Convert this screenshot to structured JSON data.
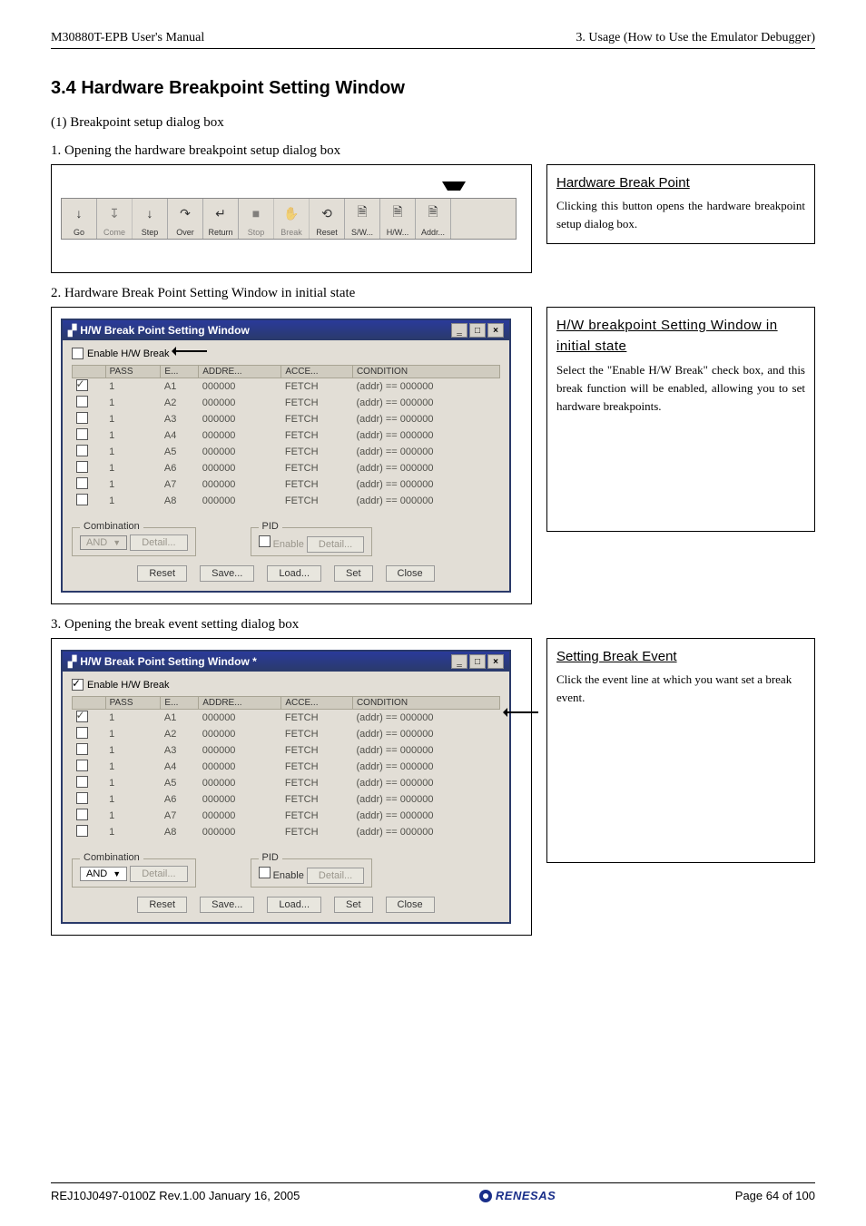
{
  "header": {
    "left": "M30880T-EPB User's Manual",
    "right": "3. Usage (How to Use the Emulator Debugger)"
  },
  "section_title": "3.4 Hardware Breakpoint Setting Window",
  "sub1": "(1) Breakpoint setup dialog box",
  "step1": "1. Opening the hardware breakpoint setup dialog box",
  "step2": "2. Hardware Break Point Setting Window in initial state",
  "step3": "3. Opening the break event setting dialog box",
  "toolbar": [
    {
      "label": "Go",
      "enabled": true,
      "icon": "↓"
    },
    {
      "label": "Come",
      "enabled": false,
      "icon": "↧"
    },
    {
      "label": "Step",
      "enabled": true,
      "icon": "↓"
    },
    {
      "label": "Over",
      "enabled": true,
      "icon": "↷"
    },
    {
      "label": "Return",
      "enabled": true,
      "icon": "↵"
    },
    {
      "label": "Stop",
      "enabled": false,
      "icon": "■"
    },
    {
      "label": "Break",
      "enabled": false,
      "icon": "✋"
    },
    {
      "label": "Reset",
      "enabled": true,
      "icon": "⟲"
    },
    {
      "label": "S/W...",
      "enabled": true,
      "icon": "🗎"
    },
    {
      "label": "H/W...",
      "enabled": true,
      "icon": "🗎"
    },
    {
      "label": "Addr...",
      "enabled": true,
      "icon": "🗎"
    }
  ],
  "info1": {
    "title": "Hardware Break Point",
    "text": "Clicking this button opens the hardware breakpoint setup dialog box."
  },
  "window_initial": {
    "title": "H/W Break Point Setting Window",
    "enable_label": "Enable H/W Break",
    "enable_checked": false,
    "cols": [
      "PASS",
      "E...",
      "ADDRE...",
      "ACCE...",
      "CONDITION"
    ],
    "rows": [
      {
        "chk": true,
        "pass": "1",
        "e": "A1",
        "addr": "000000",
        "acc": "FETCH",
        "cond": "(addr) == 000000"
      },
      {
        "chk": false,
        "pass": "1",
        "e": "A2",
        "addr": "000000",
        "acc": "FETCH",
        "cond": "(addr) == 000000"
      },
      {
        "chk": false,
        "pass": "1",
        "e": "A3",
        "addr": "000000",
        "acc": "FETCH",
        "cond": "(addr) == 000000"
      },
      {
        "chk": false,
        "pass": "1",
        "e": "A4",
        "addr": "000000",
        "acc": "FETCH",
        "cond": "(addr) == 000000"
      },
      {
        "chk": false,
        "pass": "1",
        "e": "A5",
        "addr": "000000",
        "acc": "FETCH",
        "cond": "(addr) == 000000"
      },
      {
        "chk": false,
        "pass": "1",
        "e": "A6",
        "addr": "000000",
        "acc": "FETCH",
        "cond": "(addr) == 000000"
      },
      {
        "chk": false,
        "pass": "1",
        "e": "A7",
        "addr": "000000",
        "acc": "FETCH",
        "cond": "(addr) == 000000"
      },
      {
        "chk": false,
        "pass": "1",
        "e": "A8",
        "addr": "000000",
        "acc": "FETCH",
        "cond": "(addr) == 000000"
      }
    ],
    "combination": {
      "label": "Combination",
      "combo": "AND",
      "detail": "Detail..."
    },
    "pid": {
      "label": "PID",
      "enable": "Enable",
      "detail": "Detail..."
    },
    "footer": {
      "reset": "Reset",
      "save": "Save...",
      "load": "Load...",
      "set": "Set",
      "close": "Close"
    }
  },
  "info2": {
    "title": "H/W breakpoint Setting Window in initial state",
    "text": "Select the \"Enable H/W Break\" check box, and this break function will be enabled, allowing you to set hardware breakpoints."
  },
  "window_event": {
    "title": "H/W Break Point Setting Window *",
    "enable_label": "Enable H/W Break",
    "enable_checked": true,
    "cols": [
      "PASS",
      "E...",
      "ADDRE...",
      "ACCE...",
      "CONDITION"
    ],
    "rows": [
      {
        "chk": true,
        "pass": "1",
        "e": "A1",
        "addr": "000000",
        "acc": "FETCH",
        "cond": "(addr) == 000000"
      },
      {
        "chk": false,
        "pass": "1",
        "e": "A2",
        "addr": "000000",
        "acc": "FETCH",
        "cond": "(addr) == 000000"
      },
      {
        "chk": false,
        "pass": "1",
        "e": "A3",
        "addr": "000000",
        "acc": "FETCH",
        "cond": "(addr) == 000000"
      },
      {
        "chk": false,
        "pass": "1",
        "e": "A4",
        "addr": "000000",
        "acc": "FETCH",
        "cond": "(addr) == 000000"
      },
      {
        "chk": false,
        "pass": "1",
        "e": "A5",
        "addr": "000000",
        "acc": "FETCH",
        "cond": "(addr) == 000000"
      },
      {
        "chk": false,
        "pass": "1",
        "e": "A6",
        "addr": "000000",
        "acc": "FETCH",
        "cond": "(addr) == 000000"
      },
      {
        "chk": false,
        "pass": "1",
        "e": "A7",
        "addr": "000000",
        "acc": "FETCH",
        "cond": "(addr) == 000000"
      },
      {
        "chk": false,
        "pass": "1",
        "e": "A8",
        "addr": "000000",
        "acc": "FETCH",
        "cond": "(addr) == 000000"
      }
    ],
    "combination": {
      "label": "Combination",
      "combo": "AND",
      "detail": "Detail..."
    },
    "pid": {
      "label": "PID",
      "enable": "Enable",
      "detail": "Detail..."
    },
    "footer": {
      "reset": "Reset",
      "save": "Save...",
      "load": "Load...",
      "set": "Set",
      "close": "Close"
    }
  },
  "info3": {
    "title": "Setting Break Event",
    "text": "Click the event line at which you want set a break event."
  },
  "footer": {
    "left": "REJ10J0497-0100Z   Rev.1.00   January 16, 2005",
    "brand": "RENESAS",
    "right": "Page 64 of 100"
  }
}
